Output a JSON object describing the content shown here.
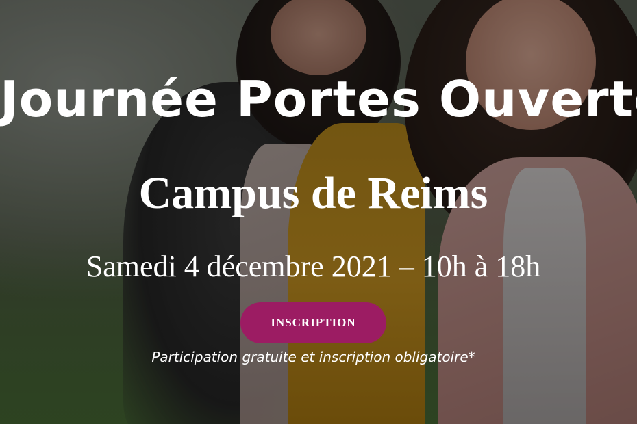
{
  "hero": {
    "headline": "Journée Portes Ouvertes",
    "campus": "Campus de Reims",
    "date": "Samedi 4 décembre 2021 – 10h à 18h",
    "cta_label": "INSCRIPTION",
    "note": "Participation gratuite et inscription obligatoire*"
  },
  "colors": {
    "cta_background": "#9c1c63",
    "text": "#ffffff"
  }
}
